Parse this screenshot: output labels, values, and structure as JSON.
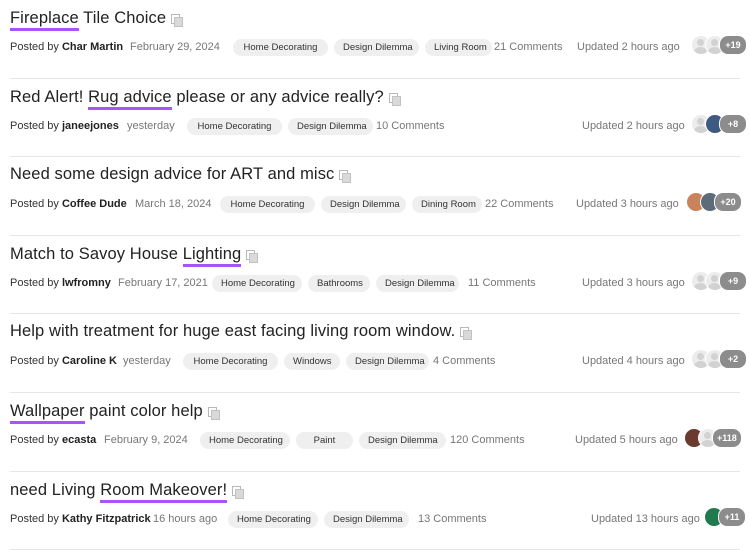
{
  "threads": [
    {
      "title_parts": [
        {
          "text": "Fireplace",
          "hl": true
        },
        {
          "text": " Tile Choice",
          "hl": false
        }
      ],
      "posted_label": "Posted by",
      "author": "Char Martin",
      "date": "February 29, 2024",
      "tags": [
        "Home Decorating",
        "Design Dilemma",
        "Living Room"
      ],
      "comments": "21 Comments",
      "updated": "Updated 2 hours ago",
      "avatars": [
        {
          "kind": "ghost",
          "color": "#e9e9e9"
        },
        {
          "kind": "ghost",
          "color": "#e9e9e9"
        }
      ],
      "more": "+19"
    },
    {
      "title_parts": [
        {
          "text": "Red Alert! ",
          "hl": false
        },
        {
          "text": "Rug advice",
          "hl": true
        },
        {
          "text": " please or any advice really?",
          "hl": false
        }
      ],
      "posted_label": "Posted by",
      "author": "janeejones",
      "date": "yesterday",
      "tags": [
        "Home Decorating",
        "Design Dilemma"
      ],
      "comments": "10 Comments",
      "updated": "Updated 2 hours ago",
      "avatars": [
        {
          "kind": "ghost",
          "color": "#e9e9e9"
        },
        {
          "kind": "photo",
          "color": "#3d5a80"
        }
      ],
      "more": "+8"
    },
    {
      "title_parts": [
        {
          "text": "Need some design advice for ART and misc",
          "hl": false
        }
      ],
      "posted_label": "Posted by",
      "author": "Coffee Dude",
      "date": "March 18, 2024",
      "tags": [
        "Home Decorating",
        "Design Dilemma",
        "Dining Room"
      ],
      "comments": "22 Comments",
      "updated": "Updated 3 hours ago",
      "avatars": [
        {
          "kind": "photo",
          "color": "#c9835c"
        },
        {
          "kind": "photo",
          "color": "#5d6b78"
        }
      ],
      "more": "+20"
    },
    {
      "title_parts": [
        {
          "text": "Match to Savoy House ",
          "hl": false
        },
        {
          "text": "Lighting",
          "hl": true
        }
      ],
      "posted_label": "Posted by",
      "author": "lwfromny",
      "date": "February 17, 2021",
      "tags": [
        "Home Decorating",
        "Bathrooms",
        "Design Dilemma"
      ],
      "comments": "11 Comments",
      "updated": "Updated 3 hours ago",
      "avatars": [
        {
          "kind": "ghost",
          "color": "#e9e9e9"
        },
        {
          "kind": "ghost",
          "color": "#e9e9e9"
        }
      ],
      "more": "+9"
    },
    {
      "title_parts": [
        {
          "text": "Help with treatment for huge east facing living room window.",
          "hl": false
        }
      ],
      "posted_label": "Posted by",
      "author": "Caroline K",
      "date": "yesterday",
      "tags": [
        "Home Decorating",
        "Windows",
        "Design Dilemma"
      ],
      "comments": "4 Comments",
      "updated": "Updated 4 hours ago",
      "avatars": [
        {
          "kind": "ghost",
          "color": "#e9e9e9"
        },
        {
          "kind": "ghost",
          "color": "#e9e9e9"
        }
      ],
      "more": "+2"
    },
    {
      "title_parts": [
        {
          "text": "Wallpaper",
          "hl": true
        },
        {
          "text": " paint color help",
          "hl": false
        }
      ],
      "posted_label": "Posted by",
      "author": "ecasta",
      "date": "February 9, 2024",
      "tags": [
        "Home Decorating",
        "Paint",
        "Design Dilemma"
      ],
      "comments": "120 Comments",
      "updated": "Updated 5 hours ago",
      "avatars": [
        {
          "kind": "photo",
          "color": "#6b3a2e"
        },
        {
          "kind": "ghost",
          "color": "#e9e9e9"
        }
      ],
      "more": "+118"
    },
    {
      "title_parts": [
        {
          "text": "need Living ",
          "hl": false
        },
        {
          "text": "Room Makeover!",
          "hl": true
        }
      ],
      "posted_label": "Posted by",
      "author": "Kathy Fitzpatrick",
      "date": "16 hours ago",
      "tags": [
        "Home Decorating",
        "Design Dilemma"
      ],
      "comments": "13 Comments",
      "updated": "Updated 13 hours ago",
      "avatars": [
        {
          "kind": "photo",
          "color": "#1f7a4d"
        }
      ],
      "more": "+11"
    }
  ]
}
